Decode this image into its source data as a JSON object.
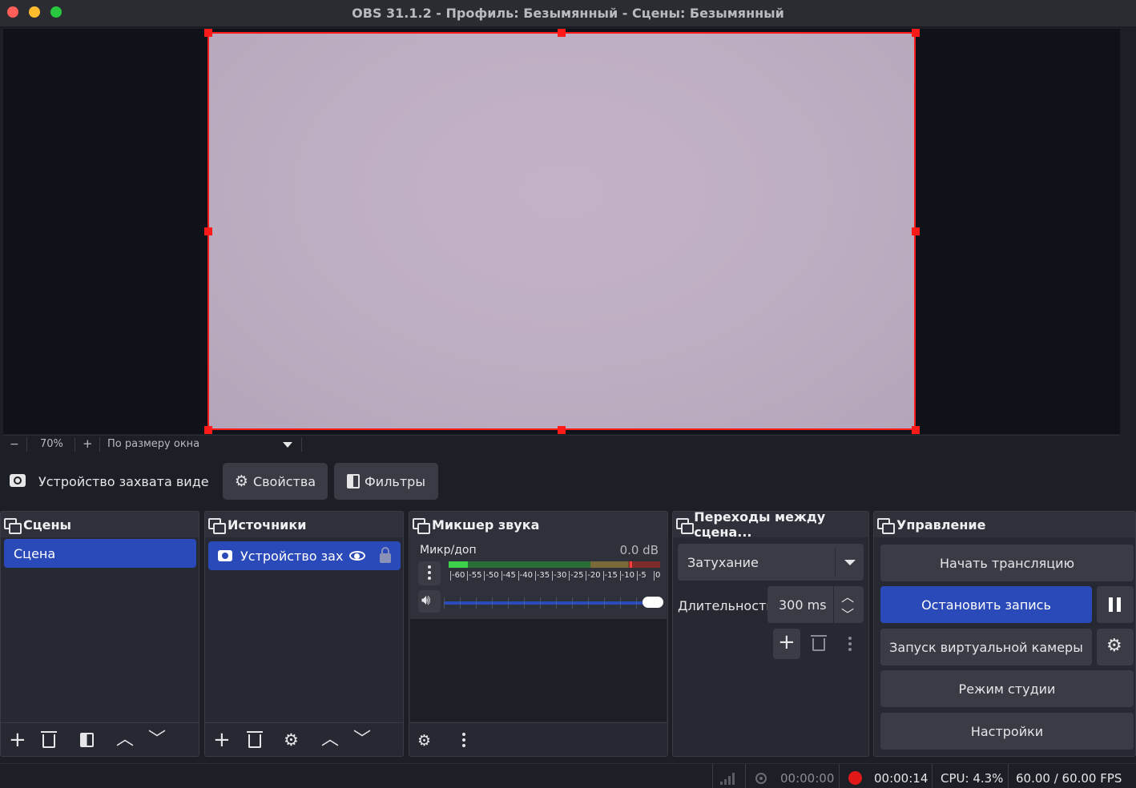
{
  "window": {
    "title": "OBS 31.1.2 - Профиль: Безымянный - Сцены: Безымянный",
    "colors": {
      "close": "#ff5f57",
      "minimize": "#febc2e",
      "maximize": "#28c840"
    }
  },
  "zoom": {
    "minus": "−",
    "level": "70%",
    "plus": "+",
    "fit_label": "По размеру окна"
  },
  "source_toolbar": {
    "source_name": "Устройство захвата видео (",
    "properties_label": "Свойства",
    "filters_label": "Фильтры"
  },
  "scenes": {
    "title": "Сцены",
    "items": [
      "Сцена"
    ]
  },
  "sources": {
    "title": "Источники",
    "items": [
      "Устройство захва"
    ]
  },
  "mixer": {
    "title": "Микшер звука",
    "channel_name": "Микр/доп",
    "level": "0.0 dB",
    "ticks": [
      "-60",
      "-55",
      "-50",
      "-45",
      "-40",
      "-35",
      "-30",
      "-25",
      "-20",
      "-15",
      "-10",
      "-5",
      "0"
    ],
    "volume_fraction": 1.0
  },
  "transitions": {
    "title": "Переходы между сцена...",
    "selected": "Затухание",
    "duration_label": "Длительность",
    "duration_value": "300 ms"
  },
  "controls": {
    "title": "Управление",
    "start_stream": "Начать трансляцию",
    "stop_record": "Остановить запись",
    "virtual_cam": "Запуск виртуальной камеры",
    "studio_mode": "Режим студии",
    "settings": "Настройки",
    "accent": "#2b4ab9"
  },
  "status": {
    "stream_time": "00:00:00",
    "record_time": "00:00:14",
    "cpu": "CPU: 4.3%",
    "fps": "60.00 / 60.00 FPS"
  }
}
